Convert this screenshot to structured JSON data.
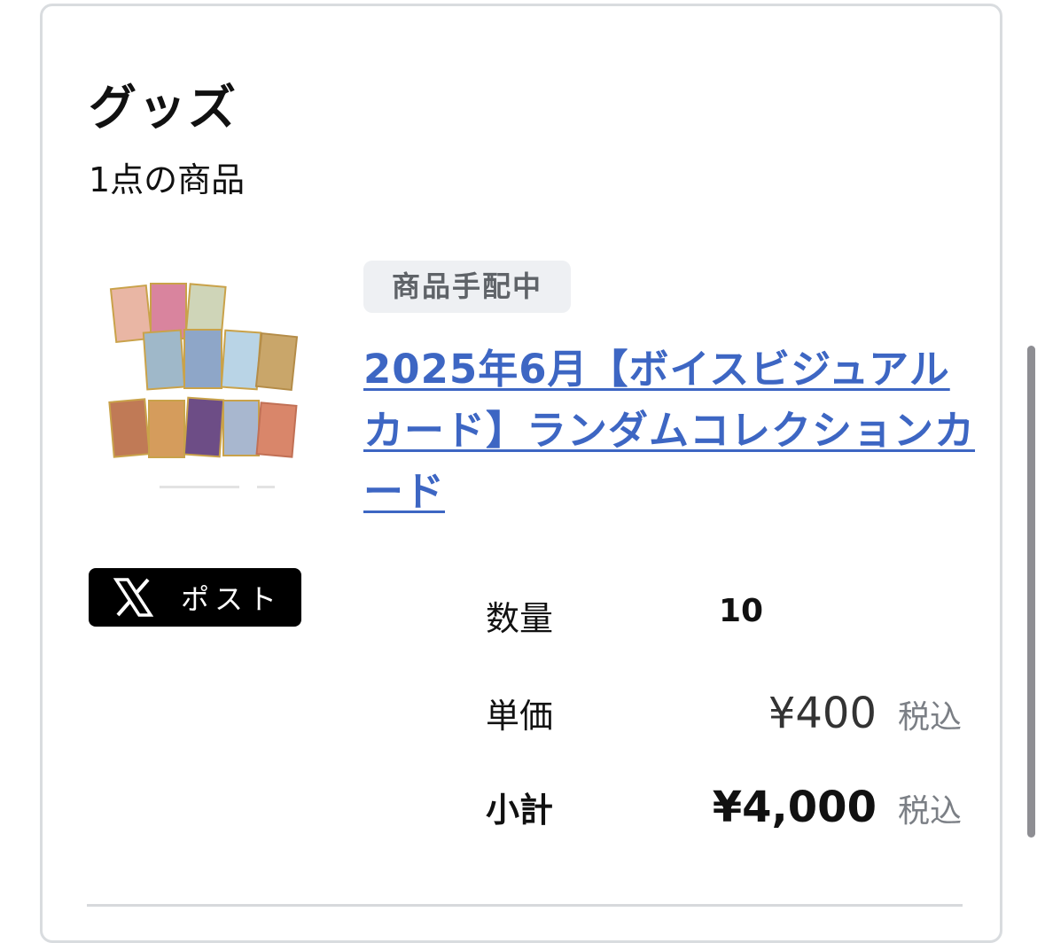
{
  "section": {
    "title": "グッズ",
    "item_count": "1点の商品"
  },
  "product": {
    "status": "商品手配中",
    "name": "2025年6月【ボイスビジュアルカード】ランダムコレクションカード",
    "image_icon": "product-collage-image"
  },
  "share": {
    "icon": "x-logo-icon",
    "label": "ポスト"
  },
  "details": {
    "quantity_label": "数量",
    "quantity_value": "10",
    "unit_price_label": "単価",
    "unit_price_value": "¥400",
    "unit_price_tax": "税込",
    "subtotal_label": "小計",
    "subtotal_value": "¥4,000",
    "subtotal_tax": "税込"
  },
  "colors": {
    "link": "#3d66c3",
    "badge_bg": "#eef0f3",
    "border": "#d9dcdf"
  }
}
